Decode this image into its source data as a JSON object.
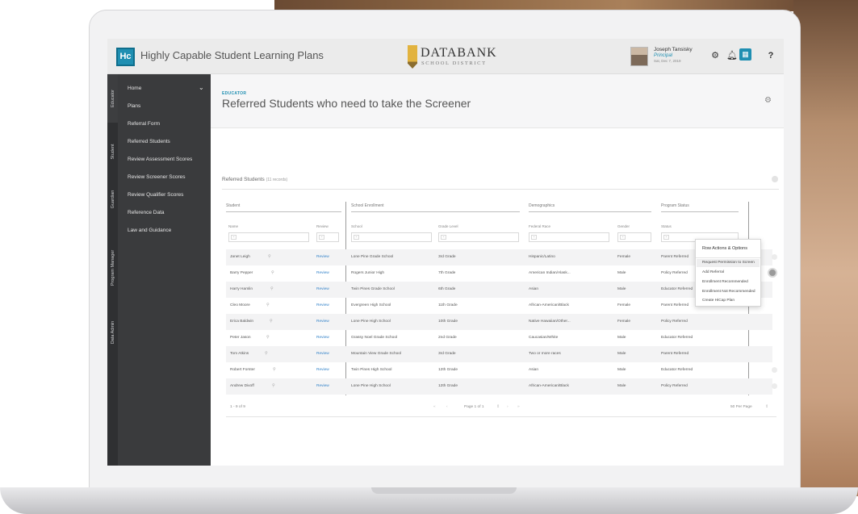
{
  "app": {
    "logo_text": "Hc",
    "title": "Highly Capable Student Learning Plans",
    "brand_name": "DATABANK",
    "brand_sub": "SCHOOL DISTRICT"
  },
  "user": {
    "name": "Joseph Tansisky",
    "role": "Principal",
    "date": "Sat, Dec 7, 2019"
  },
  "vtabs": [
    "Educator",
    "Student",
    "Guardian",
    "Program Manager",
    "Data Admin"
  ],
  "sidebar": {
    "items": [
      "Home",
      "Plans",
      "Referral Form",
      "Referred Students",
      "Review Assessment Scores",
      "Review Screener Scores",
      "Review Qualifier Scores",
      "Reference Data",
      "Law and Guidance"
    ]
  },
  "page": {
    "eyebrow": "EDUCATOR",
    "title": "Referred Students who need to take the Screener"
  },
  "card": {
    "title": "Referred Students",
    "count": "(11 records)"
  },
  "groups": {
    "student": "Student",
    "enrollment": "School Enrollment",
    "demographics": "Demographics",
    "status": "Program Status"
  },
  "columns": {
    "name": "Name",
    "review": "Review",
    "school": "School",
    "grade": "Grade Level",
    "race": "Federal Race",
    "gender": "Gender",
    "status": "Status"
  },
  "rows": [
    {
      "name": "Janet Leigh",
      "review": "Review",
      "school": "Lone Pine Grade School",
      "grade": "3rd Grade",
      "race": "Hispanic/Latino",
      "gender": "Female",
      "status": "Parent Referred"
    },
    {
      "name": "Barry Pepper",
      "review": "Review",
      "school": "Rogers Junior High",
      "grade": "7th Grade",
      "race": "American Indian/Alask...",
      "gender": "Male",
      "status": "Policy Referred"
    },
    {
      "name": "Harry Hamlin",
      "review": "Review",
      "school": "Twin Pines Grade School",
      "grade": "6th Grade",
      "race": "Asian",
      "gender": "Male",
      "status": "Educator Referred"
    },
    {
      "name": "Cleo Moore",
      "review": "Review",
      "school": "Evergreen High School",
      "grade": "11th Grade",
      "race": "African-American/Black",
      "gender": "Female",
      "status": "Parent Referred"
    },
    {
      "name": "Erica Baldwin",
      "review": "Review",
      "school": "Lone Pine High School",
      "grade": "10th Grade",
      "race": "Native Hawaiian/Other...",
      "gender": "Female",
      "status": "Policy Referred"
    },
    {
      "name": "Peter Jason",
      "review": "Review",
      "school": "Grassy Noel Grade School",
      "grade": "2nd Grade",
      "race": "Caucasian/White",
      "gender": "Male",
      "status": "Educator Referred"
    },
    {
      "name": "Tom Atkins",
      "review": "Review",
      "school": "Mountain View Grade School",
      "grade": "3rd Grade",
      "race": "Two or more races",
      "gender": "Male",
      "status": "Parent Referred"
    },
    {
      "name": "Robert Forster",
      "review": "Review",
      "school": "Twin Pines High School",
      "grade": "12th Grade",
      "race": "Asian",
      "gender": "Male",
      "status": "Educator Referred"
    },
    {
      "name": "Andrew Divoff",
      "review": "Review",
      "school": "Lone Pine High School",
      "grade": "12th Grade",
      "race": "African-American/Black",
      "gender": "Male",
      "status": "Policy Referred"
    }
  ],
  "pager": {
    "range": "1 - 9 of 9",
    "page": "Page 1 of 1",
    "per_page": "50 Per Page"
  },
  "popup": {
    "title": "Row Actions & Options",
    "items": [
      "Request Permission to Screen",
      "Add Referral",
      "Enrollment Recommended",
      "Enrollment Not Recommended",
      "Create HiCap Plan"
    ]
  }
}
